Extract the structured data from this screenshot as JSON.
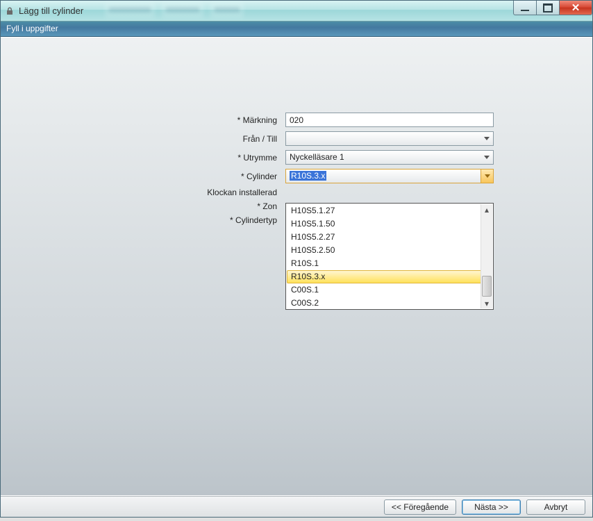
{
  "window": {
    "title": "Lägg till cylinder"
  },
  "subheader": "Fyll i uppgifter",
  "form": {
    "markning": {
      "label": "* Märkning",
      "value": "020"
    },
    "fran_till": {
      "label": "Från / Till",
      "value": ""
    },
    "utrymme": {
      "label": "* Utrymme",
      "value": "Nyckelläsare 1"
    },
    "cylinder": {
      "label": "* Cylinder",
      "value": "R10S.3.x",
      "options": [
        "H10S5.1.27",
        "H10S5.1.50",
        "H10S5.2.27",
        "H10S5.2.50",
        "R10S.1",
        "R10S.3.x",
        "C00S.1",
        "C00S.2"
      ],
      "highlighted": "R10S.3.x"
    },
    "klockan": {
      "label": "Klockan installerad"
    },
    "zon": {
      "label": "* Zon"
    },
    "cylindertyp": {
      "label": "* Cylindertyp"
    }
  },
  "footer": {
    "prev": "<< Föregående",
    "next": "Nästa >>",
    "cancel": "Avbryt"
  }
}
